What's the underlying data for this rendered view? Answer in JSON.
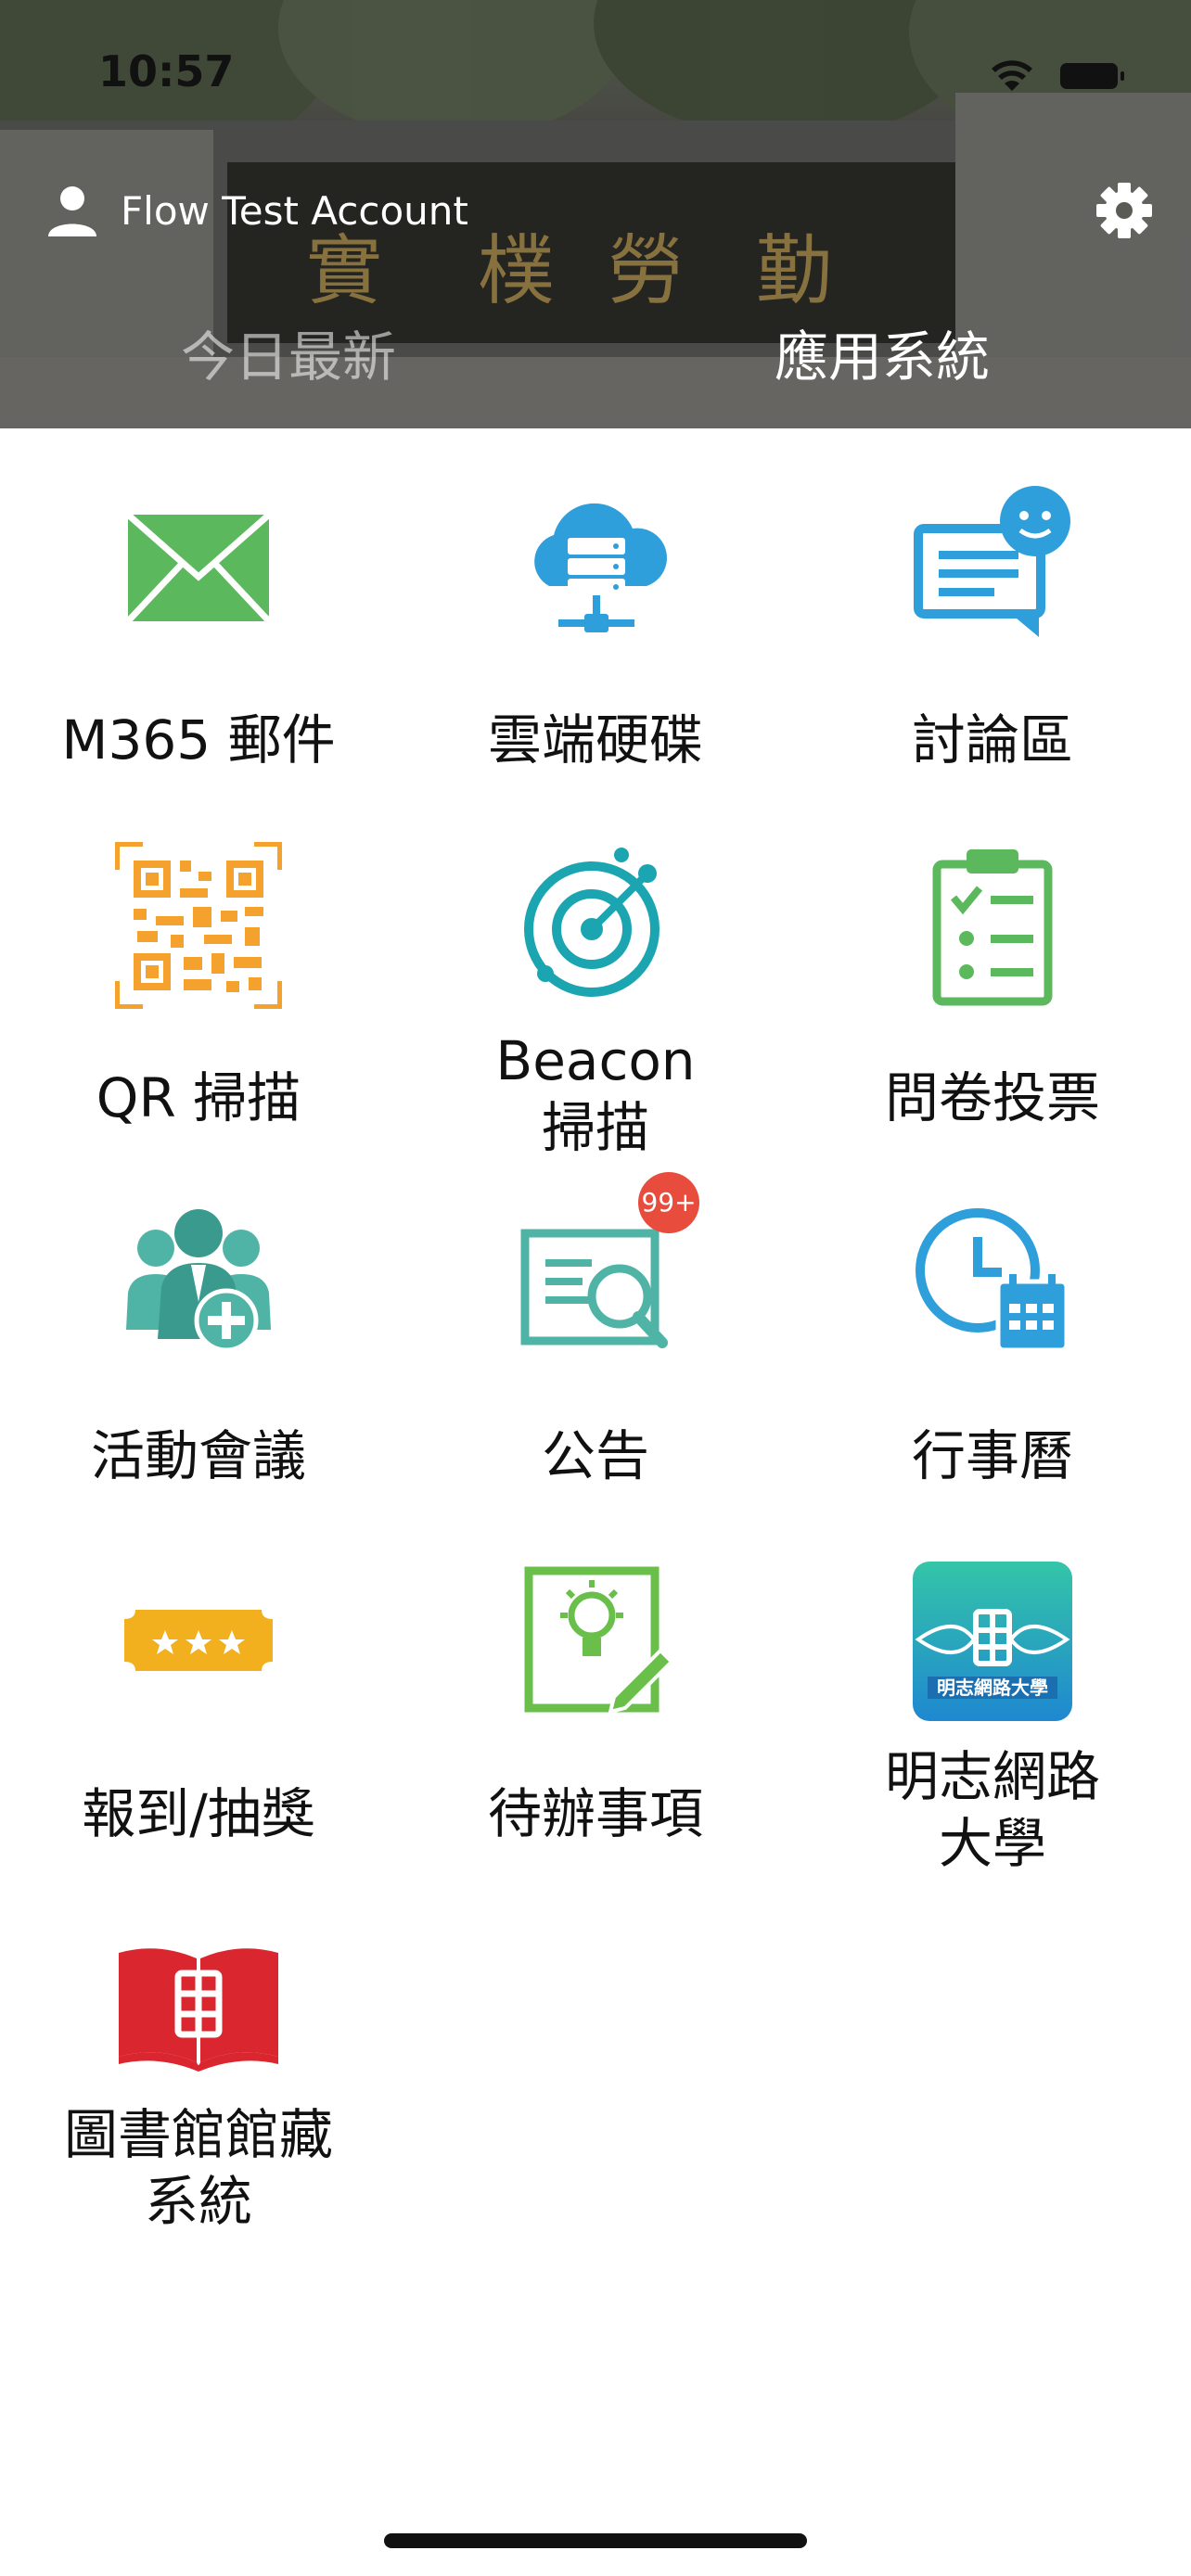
{
  "status_bar": {
    "time": "10:57"
  },
  "account": {
    "name": "Flow Test Account",
    "icon": "person-icon"
  },
  "settings": {
    "icon": "gear-icon"
  },
  "tabs": [
    {
      "label": "今日最新",
      "active": false
    },
    {
      "label": "應用系統",
      "active": true
    }
  ],
  "header_carving": [
    "實",
    "樸",
    "勞",
    "勤"
  ],
  "apps": [
    {
      "label": "M365 郵件",
      "icon": "mail-icon"
    },
    {
      "label": "雲端硬碟",
      "icon": "cloud-server-icon"
    },
    {
      "label": "討論區",
      "icon": "chat-icon"
    },
    {
      "label": "QR 掃描",
      "icon": "qr-code-icon"
    },
    {
      "label": "Beacon\n掃描",
      "icon": "radar-icon"
    },
    {
      "label": "問卷投票",
      "icon": "clipboard-checklist-icon"
    },
    {
      "label": "活動會議",
      "icon": "group-add-icon"
    },
    {
      "label": "公告",
      "icon": "announcement-search-icon",
      "badge": "99+"
    },
    {
      "label": "行事曆",
      "icon": "clock-calendar-icon"
    },
    {
      "label": "報到/抽獎",
      "icon": "ticket-icon"
    },
    {
      "label": "待辦事項",
      "icon": "idea-note-icon"
    },
    {
      "label": "明志網路\n大學",
      "icon": "mingchi-cyber-university-icon",
      "logo_text": "明志網路大學"
    },
    {
      "label": "圖書館館藏\n系統",
      "icon": "library-book-icon"
    }
  ],
  "colors": {
    "mail_green": "#5cb85c",
    "cloud_blue": "#2e9fdb",
    "qr_orange": "#f4a12e",
    "radar_teal": "#1ba5b1",
    "group_teal": "#4fb3a6",
    "badge_red": "#e74c3c",
    "ticket_yellow": "#f2b01e",
    "library_red": "#d9262f",
    "note_green": "#6abf4b"
  }
}
